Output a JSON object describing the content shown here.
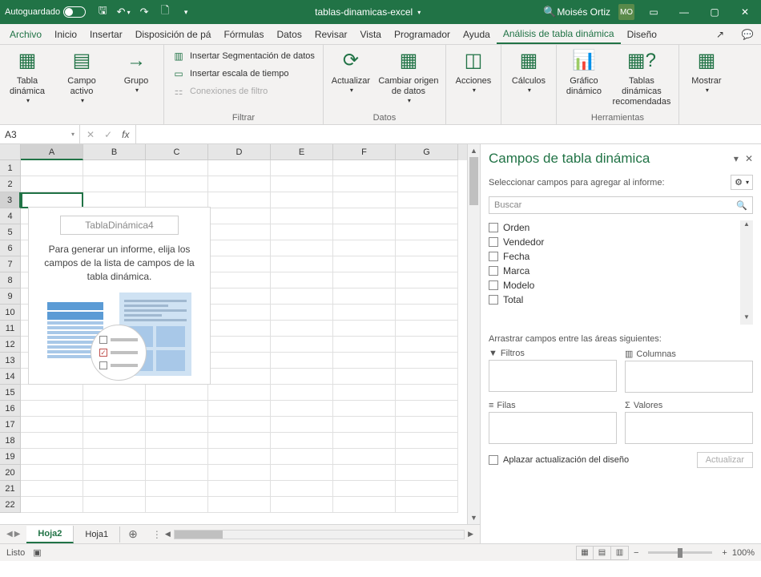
{
  "titlebar": {
    "autosave": "Autoguardado",
    "filename": "tablas-dinamicas-excel",
    "username": "Moisés Ortiz",
    "initials": "MO"
  },
  "tabs": {
    "file": "Archivo",
    "items": [
      "Inicio",
      "Insertar",
      "Disposición de pá",
      "Fórmulas",
      "Datos",
      "Revisar",
      "Vista",
      "Programador",
      "Ayuda",
      "Análisis de tabla dinámica",
      "Diseño"
    ],
    "active_index": 9
  },
  "ribbon": {
    "groups": {
      "g1": {
        "tabla": "Tabla dinámica",
        "campo": "Campo activo",
        "grupo": "Grupo"
      },
      "filtrar": {
        "label": "Filtrar",
        "seg": "Insertar Segmentación de datos",
        "escala": "Insertar escala de tiempo",
        "conex": "Conexiones de filtro"
      },
      "datos": {
        "label": "Datos",
        "actualizar": "Actualizar",
        "origen": "Cambiar origen de datos"
      },
      "acciones": "Acciones",
      "calculos": "Cálculos",
      "herramientas": {
        "label": "Herramientas",
        "grafico": "Gráfico dinámico",
        "recom": "Tablas dinámicas recomendadas"
      },
      "mostrar": "Mostrar"
    }
  },
  "namebox": "A3",
  "columns": [
    "A",
    "B",
    "C",
    "D",
    "E",
    "F",
    "G"
  ],
  "rows": [
    "1",
    "2",
    "3",
    "4",
    "5",
    "6",
    "7",
    "8",
    "9",
    "10",
    "11",
    "12",
    "13",
    "14",
    "15",
    "16",
    "17",
    "18",
    "19",
    "20",
    "21",
    "22"
  ],
  "placeholder": {
    "name": "TablaDinámica4",
    "text": "Para generar un informe, elija los campos de la lista de campos de la tabla dinámica."
  },
  "sheets": {
    "active": "Hoja2",
    "other": "Hoja1"
  },
  "pane": {
    "title": "Campos de tabla dinámica",
    "subtitle": "Seleccionar campos para agregar al informe:",
    "search": "Buscar",
    "fields": [
      "Orden",
      "Vendedor",
      "Fecha",
      "Marca",
      "Modelo",
      "Total"
    ],
    "areas_label": "Arrastrar campos entre las áreas siguientes:",
    "filtros": "Filtros",
    "columnas": "Columnas",
    "filas": "Filas",
    "valores": "Valores",
    "defer": "Aplazar actualización del diseño",
    "update": "Actualizar"
  },
  "status": {
    "ready": "Listo",
    "zoom": "100%"
  }
}
